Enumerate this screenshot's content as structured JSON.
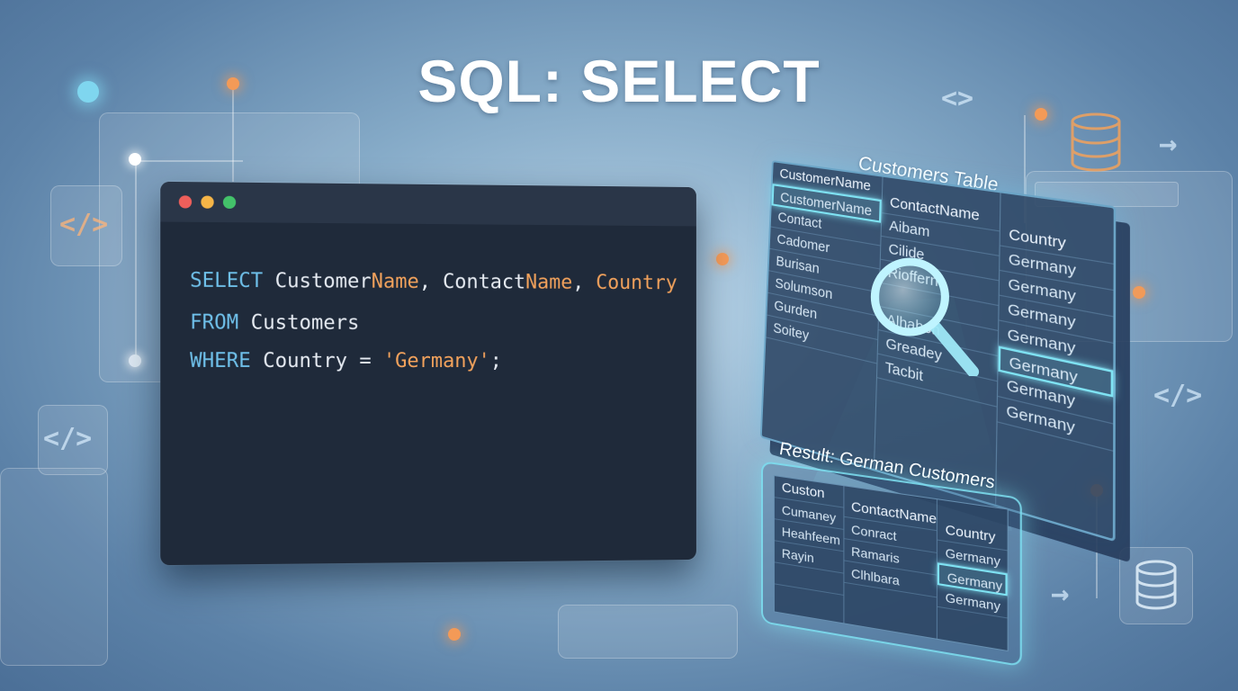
{
  "title": "SQL: SELECT",
  "colors": {
    "window_close": "#ee5f5b",
    "window_min": "#f5b547",
    "window_max": "#43c26a",
    "keyword": "#6fc0ea",
    "highlight": "#f2a25c"
  },
  "editor": {
    "line1": {
      "kw": "SELECT",
      "t1": " Customer",
      "h1": "Name",
      "t2": ", Contact",
      "h2": "Name",
      "t3": ", ",
      "h3": "Country"
    },
    "line2": {
      "kw": "FROM",
      "t1": " Customers"
    },
    "line3": {
      "kw": "WHERE",
      "t1": " Country = ",
      "str": "'Germany'",
      "t2": ";"
    }
  },
  "customers_table": {
    "caption": "Customers Table",
    "columns": [
      {
        "header": "CustomerName",
        "rows": [
          "CustomerName",
          "Contact",
          "Cadomer",
          "Burisan",
          "Solumson",
          "Gurden",
          "Soitey"
        ]
      },
      {
        "header": "ContactName",
        "rows": [
          "Aibam",
          "Cilide",
          "Rioffern",
          "",
          "Alhabon",
          "Greadey",
          "Tacbit"
        ]
      },
      {
        "header": "Country",
        "rows": [
          "Germany",
          "Germany",
          "Germany",
          "Germany",
          "Germany",
          "Germany",
          "Germany"
        ]
      }
    ]
  },
  "result_table": {
    "caption": "Result: German Customers",
    "columns": [
      {
        "header": "Custon",
        "rows": [
          "Cumaney",
          "Heahfeem",
          "Rayin",
          "",
          ""
        ]
      },
      {
        "header": "ContactName",
        "rows": [
          "Conract",
          "Ramaris",
          "Clhlbara",
          "",
          ""
        ]
      },
      {
        "header": "Country",
        "rows": [
          "Germany",
          "Germany",
          "Germany",
          "",
          ""
        ]
      }
    ]
  },
  "icons": {
    "code_left": "</>",
    "code_left_2": "</>",
    "code_right": "</>",
    "code_top": "<>",
    "arrow_right": "→"
  }
}
